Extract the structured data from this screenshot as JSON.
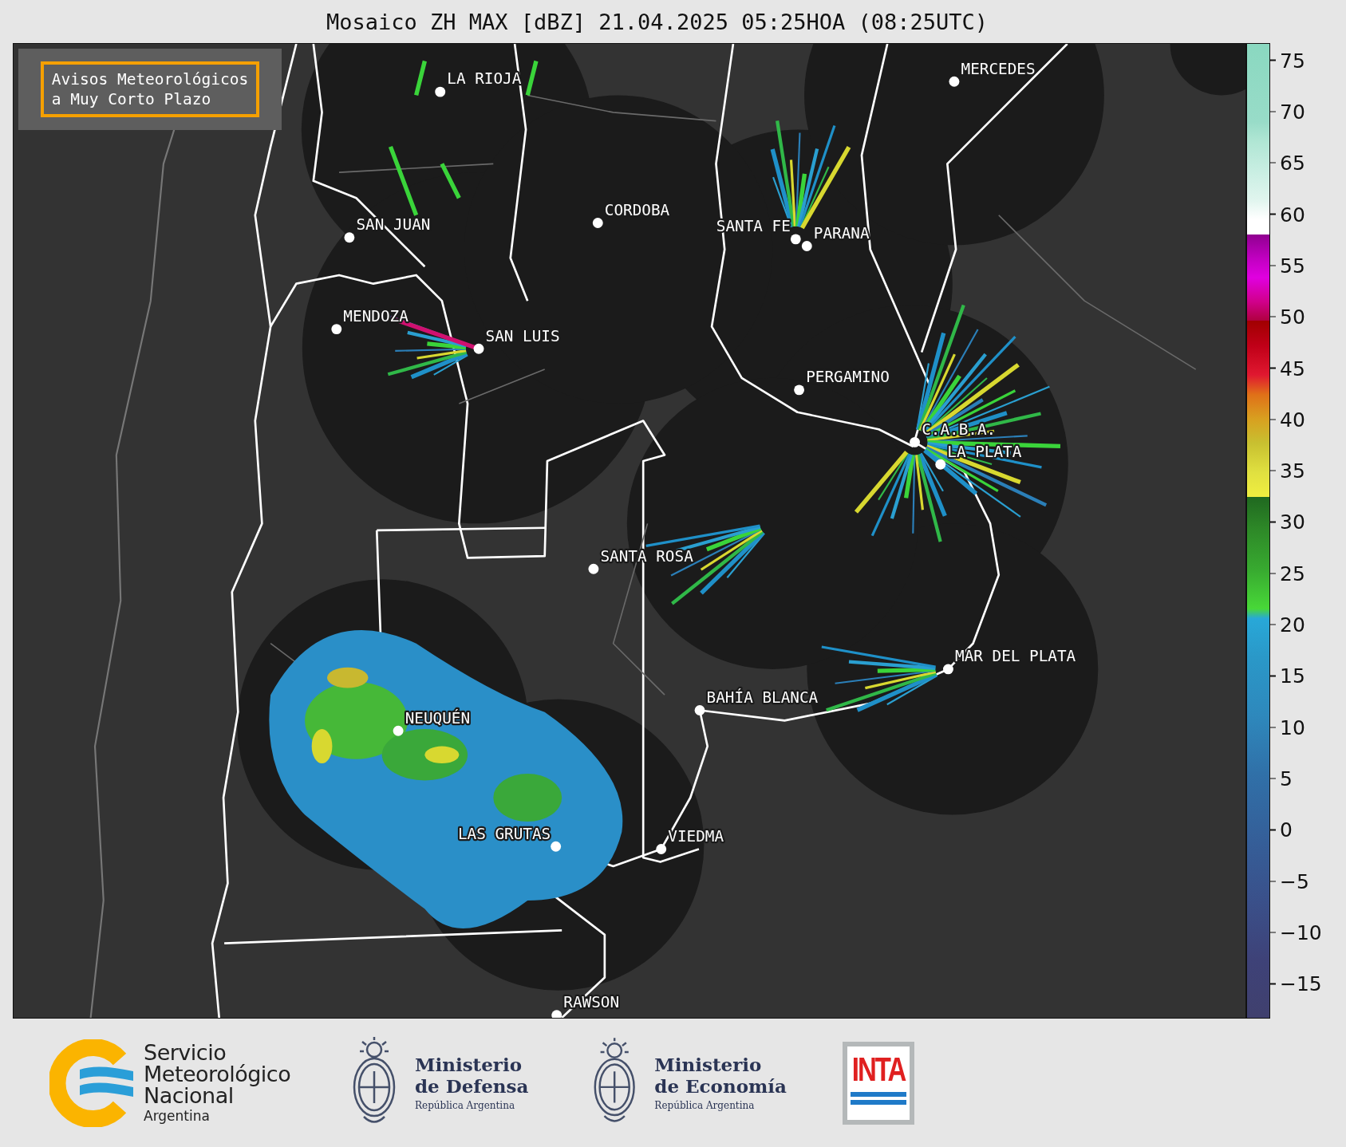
{
  "title": "Mosaico ZH MAX [dBZ] 21.04.2025 05:25HOA (08:25UTC)",
  "notice": {
    "lines": [
      "Avisos Meteorológicos",
      "a Muy Corto Plazo"
    ]
  },
  "cities": [
    {
      "name": "LA RIOJA"
    },
    {
      "name": "MERCEDES"
    },
    {
      "name": "CORDOBA"
    },
    {
      "name": "SAN JUAN"
    },
    {
      "name": "SANTA FE"
    },
    {
      "name": "PARANA"
    },
    {
      "name": "MENDOZA"
    },
    {
      "name": "SAN LUIS"
    },
    {
      "name": "PERGAMINO"
    },
    {
      "name": "C.A.B.A."
    },
    {
      "name": "LA PLATA"
    },
    {
      "name": "SANTA ROSA"
    },
    {
      "name": "MAR DEL PLATA"
    },
    {
      "name": "BAHÍA BLANCA"
    },
    {
      "name": "NEUQUÉN"
    },
    {
      "name": "LAS GRUTAS"
    },
    {
      "name": "VIEDMA"
    },
    {
      "name": "RAWSON"
    }
  ],
  "colorbar": {
    "ticks": [
      "75",
      "70",
      "65",
      "60",
      "55",
      "50",
      "45",
      "40",
      "35",
      "30",
      "25",
      "20",
      "15",
      "10",
      "5",
      "0",
      "−5",
      "−10",
      "−15"
    ]
  },
  "footer": {
    "logos": [
      {
        "kind": "smn",
        "lines": [
          "Servicio",
          "Meteorológico",
          "Nacional"
        ],
        "subtitle": "Argentina"
      },
      {
        "kind": "ministry",
        "lines": [
          "Ministerio",
          "de Defensa"
        ],
        "subtitle": "República Argentina"
      },
      {
        "kind": "ministry",
        "lines": [
          "Ministerio",
          "de Economía"
        ],
        "subtitle": "República Argentina"
      },
      {
        "kind": "inta",
        "text": "INTA"
      }
    ]
  }
}
